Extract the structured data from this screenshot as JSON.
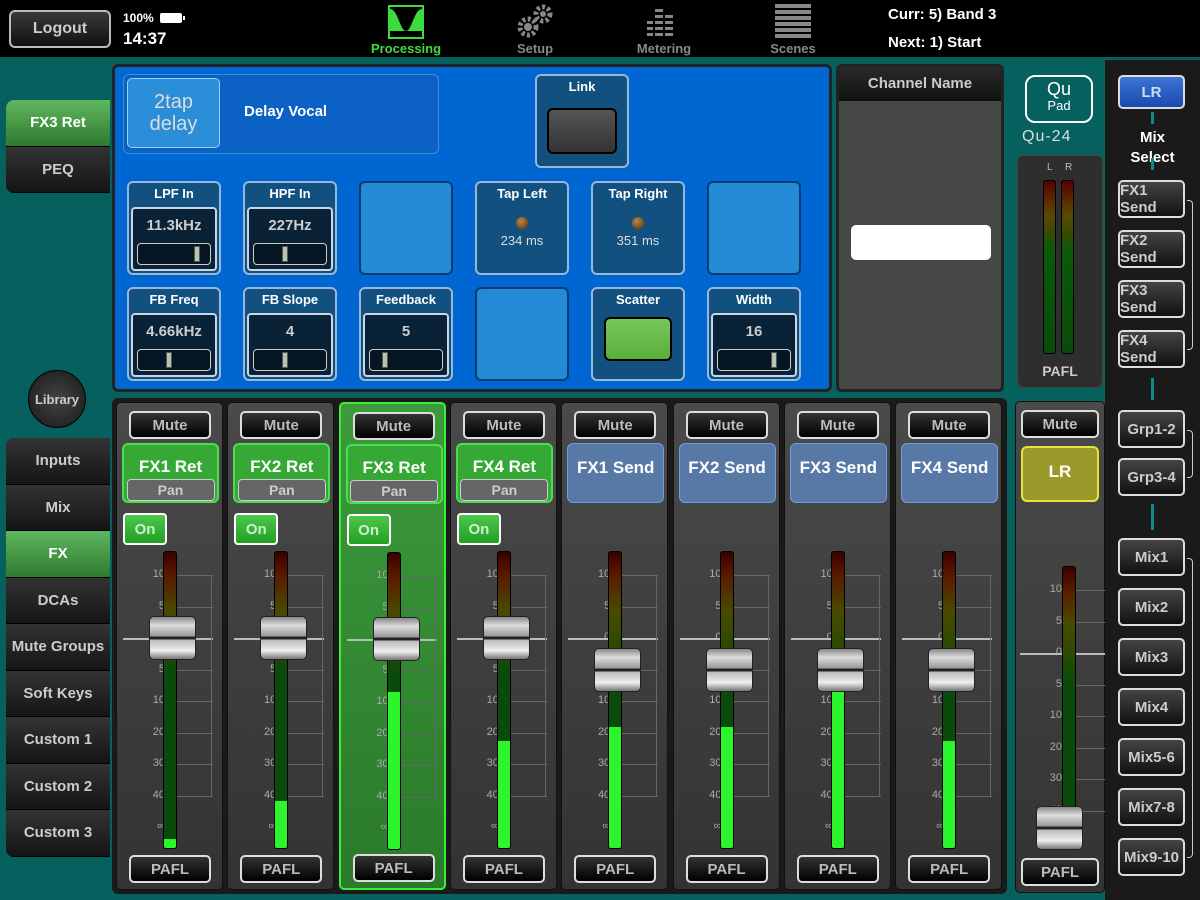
{
  "topbar": {
    "logout_label": "Logout",
    "battery": "100%",
    "time": "14:37",
    "tabs": [
      {
        "label": "Processing",
        "icon": "processing-icon",
        "active": true
      },
      {
        "label": "Setup",
        "icon": "gears-icon",
        "active": false
      },
      {
        "label": "Metering",
        "icon": "meter-bars-icon",
        "active": false
      },
      {
        "label": "Scenes",
        "icon": "scenes-list-icon",
        "active": false
      }
    ],
    "scene_current": "Curr: 5) Band 3",
    "scene_next": "Next: 1) Start"
  },
  "processing_tabs": [
    {
      "label": "FX3 Ret",
      "active": true
    },
    {
      "label": "PEQ",
      "active": false
    }
  ],
  "library_label": "Library",
  "layers": [
    {
      "label": "Inputs",
      "active": false
    },
    {
      "label": "Mix",
      "active": false
    },
    {
      "label": "FX",
      "active": true
    },
    {
      "label": "DCAs",
      "active": false
    },
    {
      "label": "Mute Groups",
      "active": false
    },
    {
      "label": "Soft Keys",
      "active": false
    },
    {
      "label": "Custom 1",
      "active": false
    },
    {
      "label": "Custom 2",
      "active": false
    },
    {
      "label": "Custom 3",
      "active": false
    }
  ],
  "fx": {
    "logo_line1": "2tap",
    "logo_line2": "delay",
    "preset_name": "Delay Vocal",
    "link_label": "Link",
    "params": {
      "lpf_in": {
        "label": "LPF In",
        "value": "11.3kHz",
        "position": 0.9
      },
      "hpf_in": {
        "label": "HPF In",
        "value": "227Hz",
        "position": 0.45
      },
      "tap_left": {
        "label": "Tap Left",
        "value": "234 ms"
      },
      "tap_right": {
        "label": "Tap Right",
        "value": "351 ms"
      },
      "fb_freq": {
        "label": "FB Freq",
        "value": "4.66kHz",
        "position": 0.45
      },
      "fb_slope": {
        "label": "FB Slope",
        "value": "4",
        "position": 0.45
      },
      "feedback": {
        "label": "Feedback",
        "value": "5",
        "position": 0.2
      },
      "scatter": {
        "label": "Scatter",
        "on": true
      },
      "width": {
        "label": "Width",
        "value": "16",
        "position": 0.85
      }
    }
  },
  "channel_name": {
    "title": "Channel Name",
    "value": ""
  },
  "scale_labels": [
    "10",
    "5",
    "0",
    "5",
    "10",
    "20",
    "30",
    "40",
    "∞"
  ],
  "strips": [
    {
      "name": "FX1 Ret",
      "type": "ret",
      "mute": "Mute",
      "pan": "Pan",
      "on": "On",
      "pafl": "PAFL",
      "fader_db": 0,
      "meter_level": 0.03,
      "selected": false
    },
    {
      "name": "FX2 Ret",
      "type": "ret",
      "mute": "Mute",
      "pan": "Pan",
      "on": "On",
      "pafl": "PAFL",
      "fader_db": 0,
      "meter_level": 0.16,
      "selected": false
    },
    {
      "name": "FX3 Ret",
      "type": "ret",
      "mute": "Mute",
      "pan": "Pan",
      "on": "On",
      "pafl": "PAFL",
      "fader_db": 0,
      "meter_level": 0.53,
      "selected": true
    },
    {
      "name": "FX4 Ret",
      "type": "ret",
      "mute": "Mute",
      "pan": "Pan",
      "on": "On",
      "pafl": "PAFL",
      "fader_db": 0,
      "meter_level": 0.36,
      "selected": false
    },
    {
      "name": "FX1 Send",
      "type": "send",
      "mute": "Mute",
      "pafl": "PAFL",
      "fader_db": -5,
      "meter_level": 0.41,
      "selected": false
    },
    {
      "name": "FX2 Send",
      "type": "send",
      "mute": "Mute",
      "pafl": "PAFL",
      "fader_db": -5,
      "meter_level": 0.41,
      "selected": false
    },
    {
      "name": "FX3 Send",
      "type": "send",
      "mute": "Mute",
      "pafl": "PAFL",
      "fader_db": -5,
      "meter_level": 0.6,
      "selected": false
    },
    {
      "name": "FX4 Send",
      "type": "send",
      "mute": "Mute",
      "pafl": "PAFL",
      "fader_db": -5,
      "meter_level": 0.36,
      "selected": false
    }
  ],
  "master": {
    "logo_line1": "Qu",
    "logo_line2": "Pad",
    "model": "Qu-24",
    "meter_l_label": "L",
    "meter_r_label": "R",
    "pafl_label": "PAFL",
    "mute": "Mute",
    "name": "LR",
    "pafl": "PAFL",
    "fader_db": "-∞"
  },
  "mix_select": {
    "label_line1": "Mix",
    "label_line2": "Select",
    "buttons": [
      {
        "label": "LR",
        "selected": true
      },
      {
        "label": "FX1 Send"
      },
      {
        "label": "FX2 Send"
      },
      {
        "label": "FX3 Send"
      },
      {
        "label": "FX4 Send"
      },
      {
        "label": "Grp1-2"
      },
      {
        "label": "Grp3-4"
      },
      {
        "label": "Mix1"
      },
      {
        "label": "Mix2"
      },
      {
        "label": "Mix3"
      },
      {
        "label": "Mix4"
      },
      {
        "label": "Mix5-6"
      },
      {
        "label": "Mix7-8"
      },
      {
        "label": "Mix9-10"
      }
    ]
  }
}
